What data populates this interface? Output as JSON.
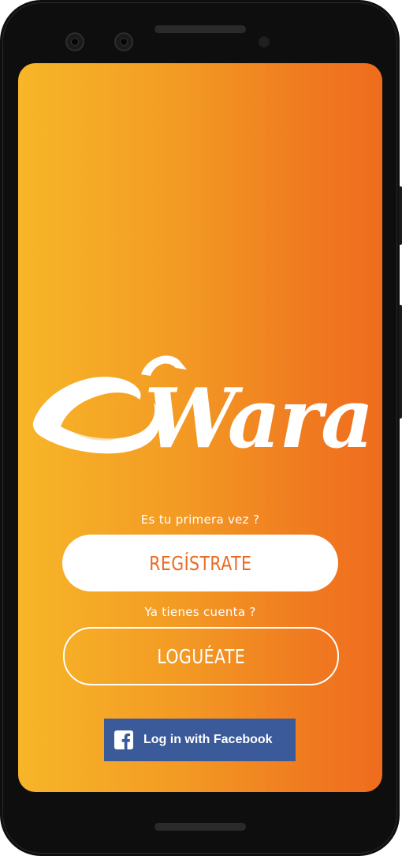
{
  "app": {
    "name": "Wara"
  },
  "colors": {
    "gradient_left": "#f7b628",
    "gradient_right": "#ef6c1e",
    "accent_text": "#ea6a23",
    "facebook_blue": "#3b5a9a"
  },
  "logo": {
    "text": "Wara",
    "icon": "chili-pepper-icon"
  },
  "register": {
    "prompt": "Es tu primera vez ?",
    "button_label": "REGÍSTRATE"
  },
  "login": {
    "prompt": "Ya tienes cuenta ?",
    "button_label": "LOGUÉATE"
  },
  "facebook": {
    "button_label": "Log in with Facebook",
    "icon": "facebook-icon"
  }
}
